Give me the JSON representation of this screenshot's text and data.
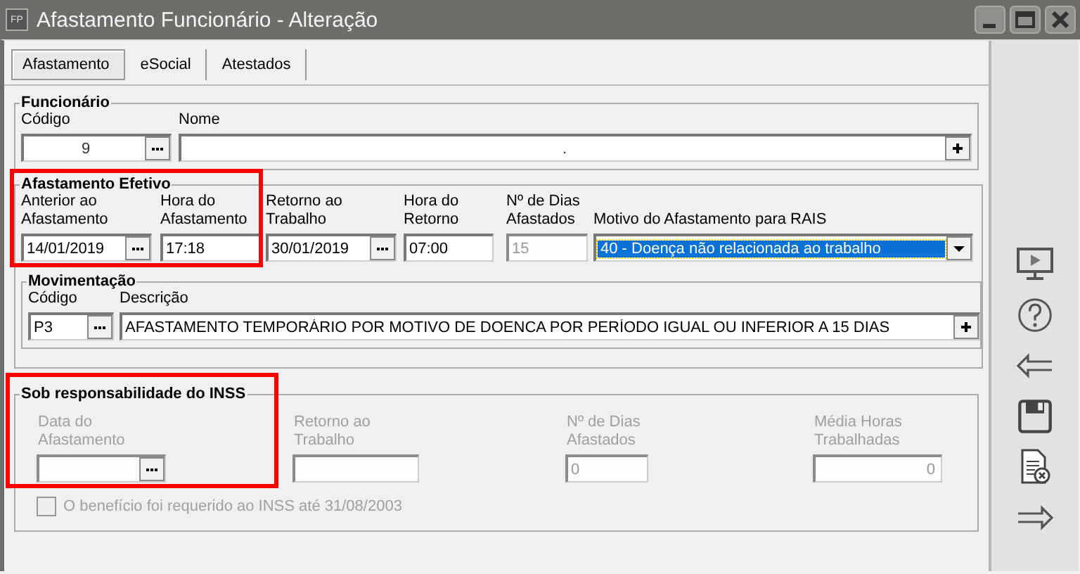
{
  "window": {
    "title": "Afastamento Funcionário - Alteração",
    "app_badge": "FP"
  },
  "tabs": [
    {
      "label": "Afastamento",
      "selected": true
    },
    {
      "label": "eSocial",
      "selected": false
    },
    {
      "label": "Atestados",
      "selected": false
    }
  ],
  "funcionario": {
    "title": "Funcionário",
    "fields": [
      {
        "label": "Código",
        "value": "9",
        "kind": "lookup",
        "disabled": false
      },
      {
        "label": "Nome",
        "value": ".",
        "kind": "expand",
        "disabled": false
      }
    ]
  },
  "afastamento_efetivo": {
    "title": "Afastamento Efetivo",
    "fields": [
      {
        "label": "Anterior ao\nAfastamento",
        "value": "14/01/2019",
        "kind": "lookup",
        "disabled": false
      },
      {
        "label": "Hora do\nAfastamento",
        "value": "17:18",
        "kind": "text",
        "disabled": false
      },
      {
        "label": "Retorno ao\nTrabalho",
        "value": "30/01/2019",
        "kind": "lookup",
        "disabled": false
      },
      {
        "label": "Hora do\nRetorno",
        "value": "07:00",
        "kind": "text",
        "disabled": false
      },
      {
        "label": "Nº de Dias\nAfastados",
        "value": "15",
        "kind": "text",
        "disabled": true
      },
      {
        "label": "Motivo do Afastamento para RAIS",
        "value": "40 - Doença não relacionada ao trabalho",
        "kind": "select",
        "disabled": false
      }
    ]
  },
  "movimentacao": {
    "title": "Movimentação",
    "fields": [
      {
        "label": "Código",
        "value": "P3",
        "kind": "lookup",
        "disabled": false
      },
      {
        "label": "Descrição",
        "value": "AFASTAMENTO TEMPORÁRIO POR MOTIVO DE DOENCA POR PERÍODO IGUAL OU INFERIOR A 15 DIAS",
        "kind": "expand",
        "disabled": false
      }
    ]
  },
  "inss": {
    "title": "Sob responsabilidade do INSS",
    "fields": [
      {
        "label": "Data do\nAfastamento",
        "kind": "lookup",
        "disabled": true
      },
      {
        "label": "Retorno ao\nTrabalho",
        "kind": "text",
        "disabled": true
      },
      {
        "label": "Nº de Dias\nAfastados",
        "value": "0",
        "kind": "text",
        "disabled": true
      },
      {
        "label": "Média Horas\nTrabalhadas",
        "value": "0",
        "kind": "text",
        "disabled": true
      }
    ],
    "checkbox": {
      "label": "O benefício foi requerido ao INSS até 31/08/2003",
      "checked": false,
      "disabled": true
    }
  }
}
